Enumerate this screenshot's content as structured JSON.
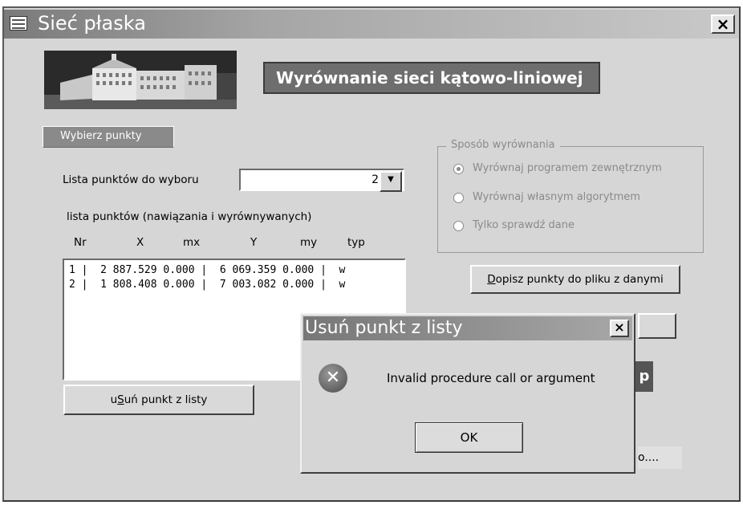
{
  "window": {
    "title": "Sieć płaska",
    "close_label": "×"
  },
  "header": {
    "title": "Wyrównanie sieci kątowo-liniowej"
  },
  "pick_points_label": "Wybierz punkty",
  "combo": {
    "label": "Lista punktów do wyboru",
    "value": "2",
    "arrow": "▼"
  },
  "list": {
    "heading": "lista punktów (nawiązania i wyrównywanych)",
    "columns": [
      "Nr",
      "X",
      "mx",
      "Y",
      "my",
      "typ"
    ],
    "rows": [
      "1 |  2 887.529 0.000 |  6 069.359 0.000 |  w",
      "2 |  1 808.408 0.000 |  7 003.082 0.000 |  w"
    ]
  },
  "remove_button": {
    "prefix": "u",
    "accel": "S",
    "rest": "uń punkt z listy"
  },
  "method_group": {
    "legend": "Sposób wyrównania",
    "options": [
      {
        "label": "Wyrównaj programem zewnętrznym",
        "selected": true
      },
      {
        "label": "Wyrównaj własnym algorytmem",
        "selected": false
      },
      {
        "label": "Tylko sprawdź dane",
        "selected": false
      }
    ]
  },
  "append_button": {
    "accel": "D",
    "rest": "opisz punkty do pliku z danymi"
  },
  "partial_button_text": "p",
  "partial_text": "o....",
  "dialog": {
    "title": "Usuń punkt z listy",
    "close_label": "×",
    "icon": "error-icon",
    "message": "Invalid procedure call or argument",
    "ok_label": "OK"
  }
}
